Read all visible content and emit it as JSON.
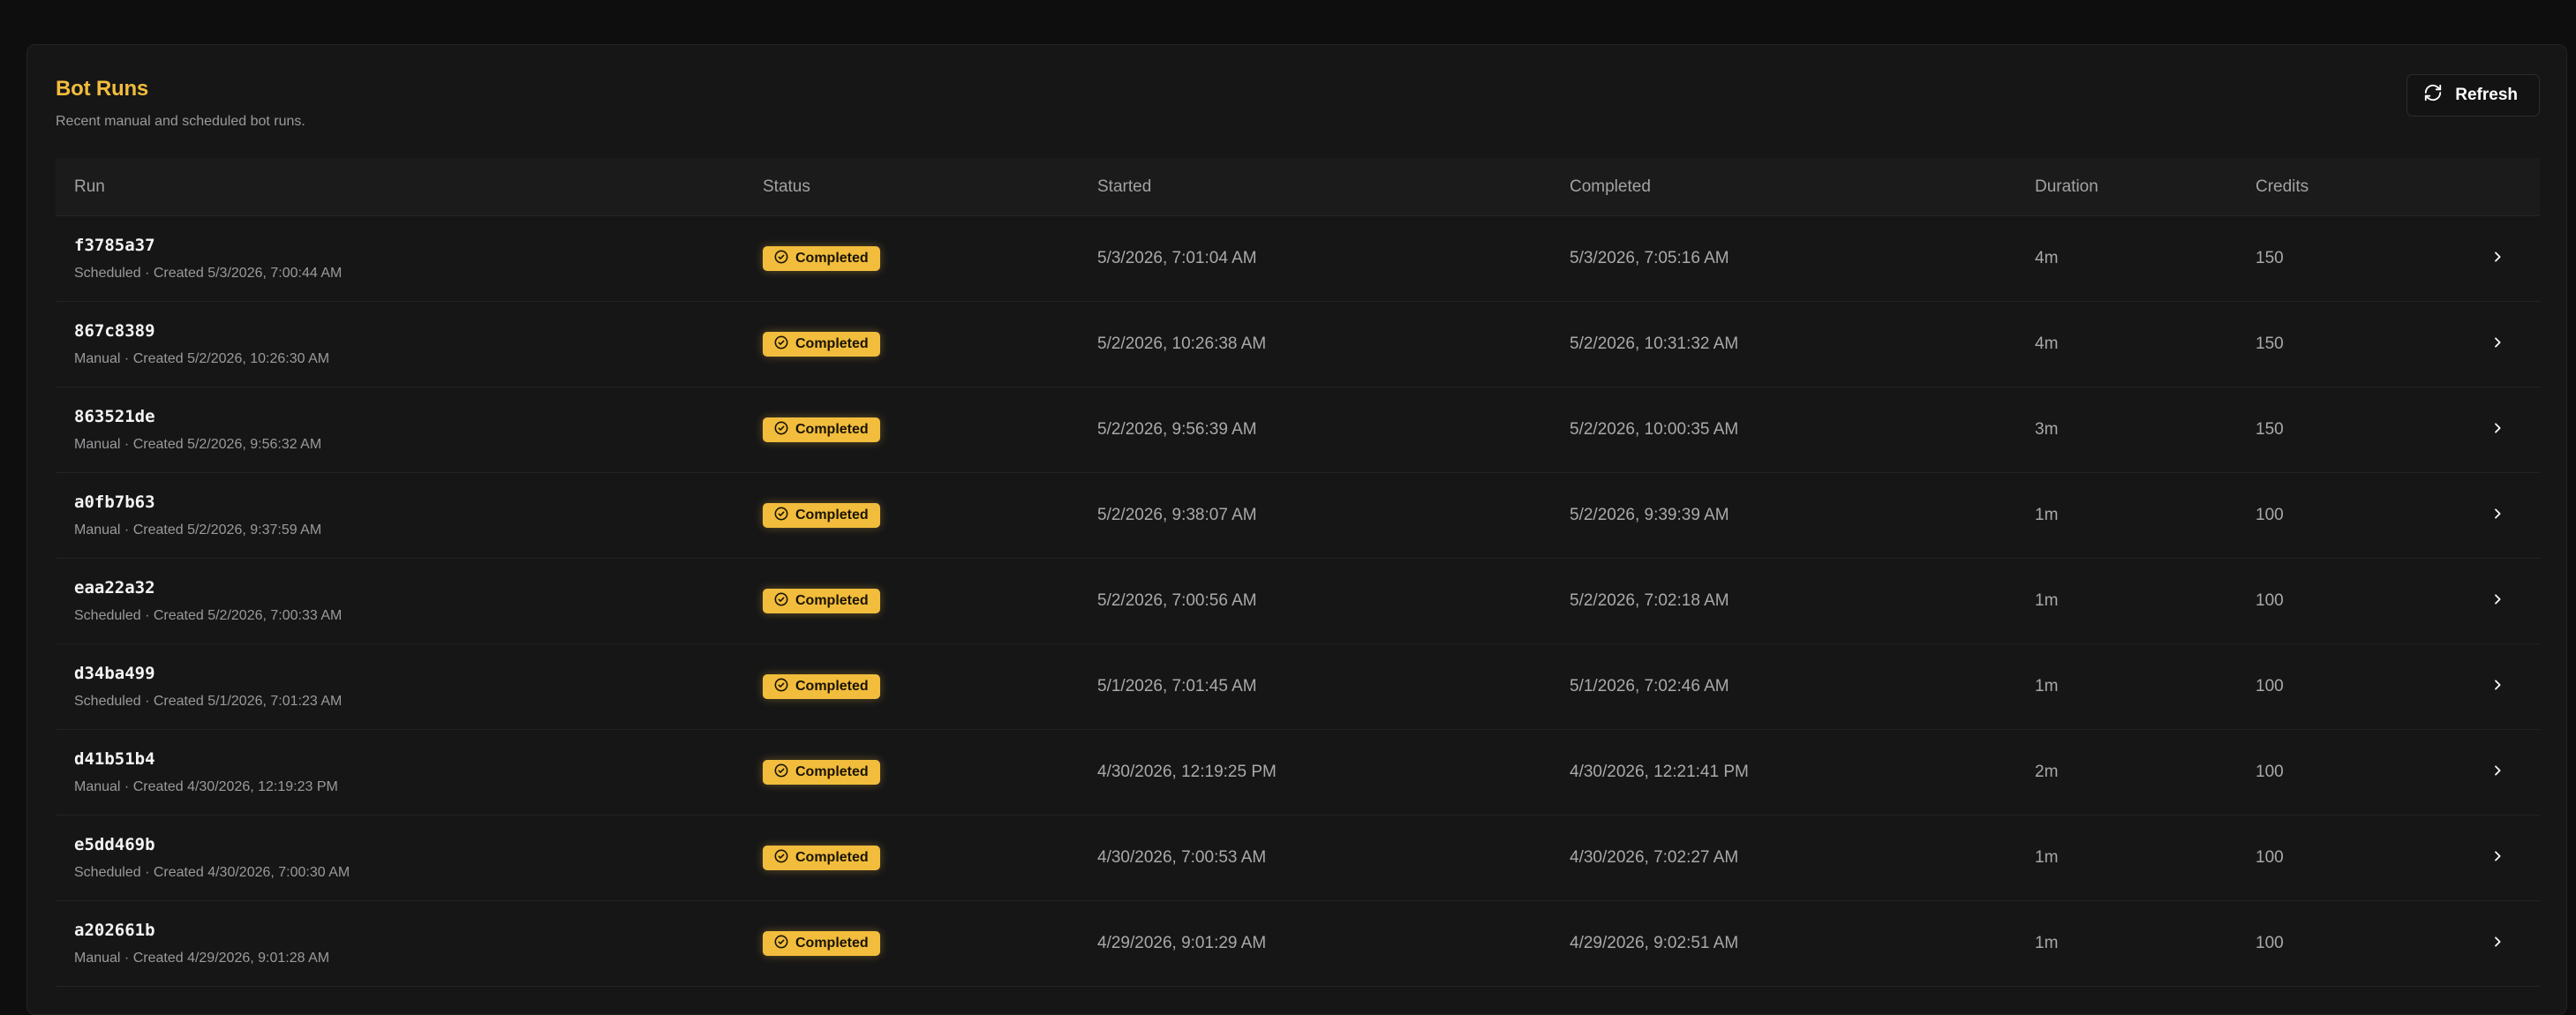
{
  "card": {
    "title": "Bot Runs",
    "subtitle": "Recent manual and scheduled bot runs.",
    "refresh_label": "Refresh"
  },
  "colors": {
    "accent": "#f2bd3c",
    "background": "#0e0e0f",
    "card": "#161617"
  },
  "table": {
    "headers": {
      "run": "Run",
      "status": "Status",
      "started": "Started",
      "completed": "Completed",
      "duration": "Duration",
      "credits": "Credits"
    },
    "rows": [
      {
        "id": "f3785a37",
        "meta": "Scheduled · Created 5/3/2026, 7:00:44 AM",
        "status": "Completed",
        "started": "5/3/2026, 7:01:04 AM",
        "completed": "5/3/2026, 7:05:16 AM",
        "duration": "4m",
        "credits": "150"
      },
      {
        "id": "867c8389",
        "meta": "Manual · Created 5/2/2026, 10:26:30 AM",
        "status": "Completed",
        "started": "5/2/2026, 10:26:38 AM",
        "completed": "5/2/2026, 10:31:32 AM",
        "duration": "4m",
        "credits": "150"
      },
      {
        "id": "863521de",
        "meta": "Manual · Created 5/2/2026, 9:56:32 AM",
        "status": "Completed",
        "started": "5/2/2026, 9:56:39 AM",
        "completed": "5/2/2026, 10:00:35 AM",
        "duration": "3m",
        "credits": "150"
      },
      {
        "id": "a0fb7b63",
        "meta": "Manual · Created 5/2/2026, 9:37:59 AM",
        "status": "Completed",
        "started": "5/2/2026, 9:38:07 AM",
        "completed": "5/2/2026, 9:39:39 AM",
        "duration": "1m",
        "credits": "100"
      },
      {
        "id": "eaa22a32",
        "meta": "Scheduled · Created 5/2/2026, 7:00:33 AM",
        "status": "Completed",
        "started": "5/2/2026, 7:00:56 AM",
        "completed": "5/2/2026, 7:02:18 AM",
        "duration": "1m",
        "credits": "100"
      },
      {
        "id": "d34ba499",
        "meta": "Scheduled · Created 5/1/2026, 7:01:23 AM",
        "status": "Completed",
        "started": "5/1/2026, 7:01:45 AM",
        "completed": "5/1/2026, 7:02:46 AM",
        "duration": "1m",
        "credits": "100"
      },
      {
        "id": "d41b51b4",
        "meta": "Manual · Created 4/30/2026, 12:19:23 PM",
        "status": "Completed",
        "started": "4/30/2026, 12:19:25 PM",
        "completed": "4/30/2026, 12:21:41 PM",
        "duration": "2m",
        "credits": "100"
      },
      {
        "id": "e5dd469b",
        "meta": "Scheduled · Created 4/30/2026, 7:00:30 AM",
        "status": "Completed",
        "started": "4/30/2026, 7:00:53 AM",
        "completed": "4/30/2026, 7:02:27 AM",
        "duration": "1m",
        "credits": "100"
      },
      {
        "id": "a202661b",
        "meta": "Manual · Created 4/29/2026, 9:01:28 AM",
        "status": "Completed",
        "started": "4/29/2026, 9:01:29 AM",
        "completed": "4/29/2026, 9:02:51 AM",
        "duration": "1m",
        "credits": "100"
      }
    ]
  },
  "icons": {
    "refresh": "refresh-icon",
    "status": "check-circle-icon",
    "row_action": "chevron-right-icon"
  }
}
